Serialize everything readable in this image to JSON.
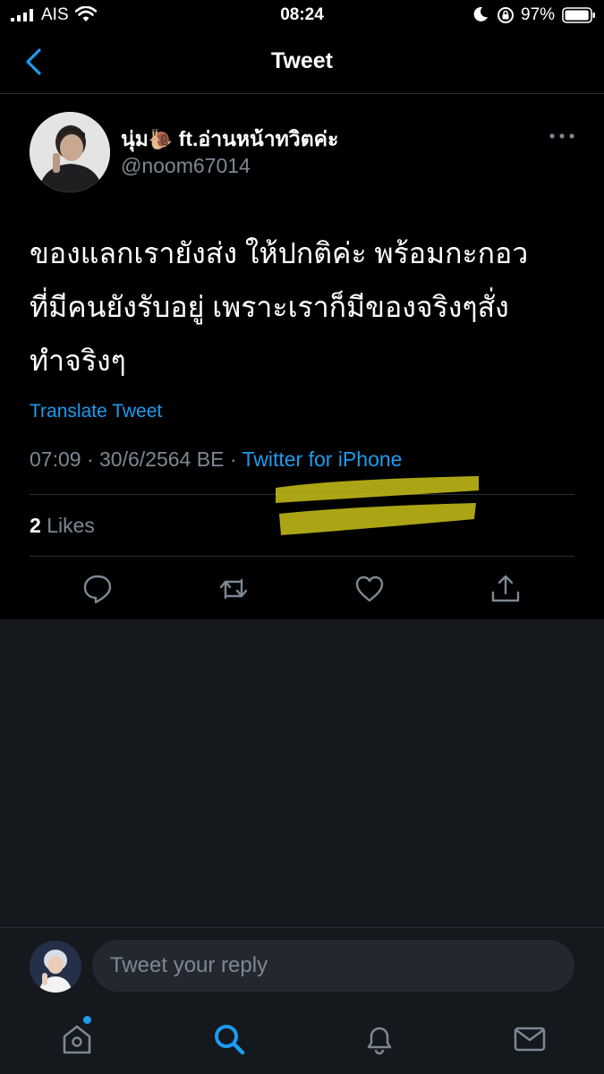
{
  "status_bar": {
    "carrier": "AIS",
    "time": "08:24",
    "battery_percent": "97%",
    "battery_level": 0.97
  },
  "header": {
    "title": "Tweet"
  },
  "tweet": {
    "display_name": "นุ่ม",
    "name_emoji": "🐌",
    "name_suffix": " ft.อ่านหน้าทวิตค่ะ",
    "handle": "@noom67014",
    "text_lines": [
      "ของแลกเรายังส่ง ให้ปกติค่ะ พร้อมกะกอว",
      "ที่มีคนยังรับอยู่ เพราะเราก็มีของจริงๆสั่ง",
      "ทำจริงๆ"
    ],
    "translate_label": "Translate Tweet",
    "time": "07:09",
    "date": "30/6/2564 BE",
    "separator": "·",
    "source": "Twitter for iPhone",
    "likes_count": "2",
    "likes_label": "Likes"
  },
  "reply": {
    "placeholder": "Tweet your reply"
  },
  "colors": {
    "accent": "#1d9bf0",
    "background": "#15181d",
    "tweet_background": "#000000",
    "secondary_text": "#7d8894",
    "highlighter": "#c9c21a"
  },
  "icons": {
    "back": "chevron-left-icon",
    "more": "more-horizontal-icon",
    "reply": "reply-icon",
    "retweet": "retweet-icon",
    "like": "heart-icon",
    "share": "share-icon",
    "tabs": [
      "home-icon",
      "search-icon",
      "notifications-icon",
      "messages-icon"
    ]
  }
}
